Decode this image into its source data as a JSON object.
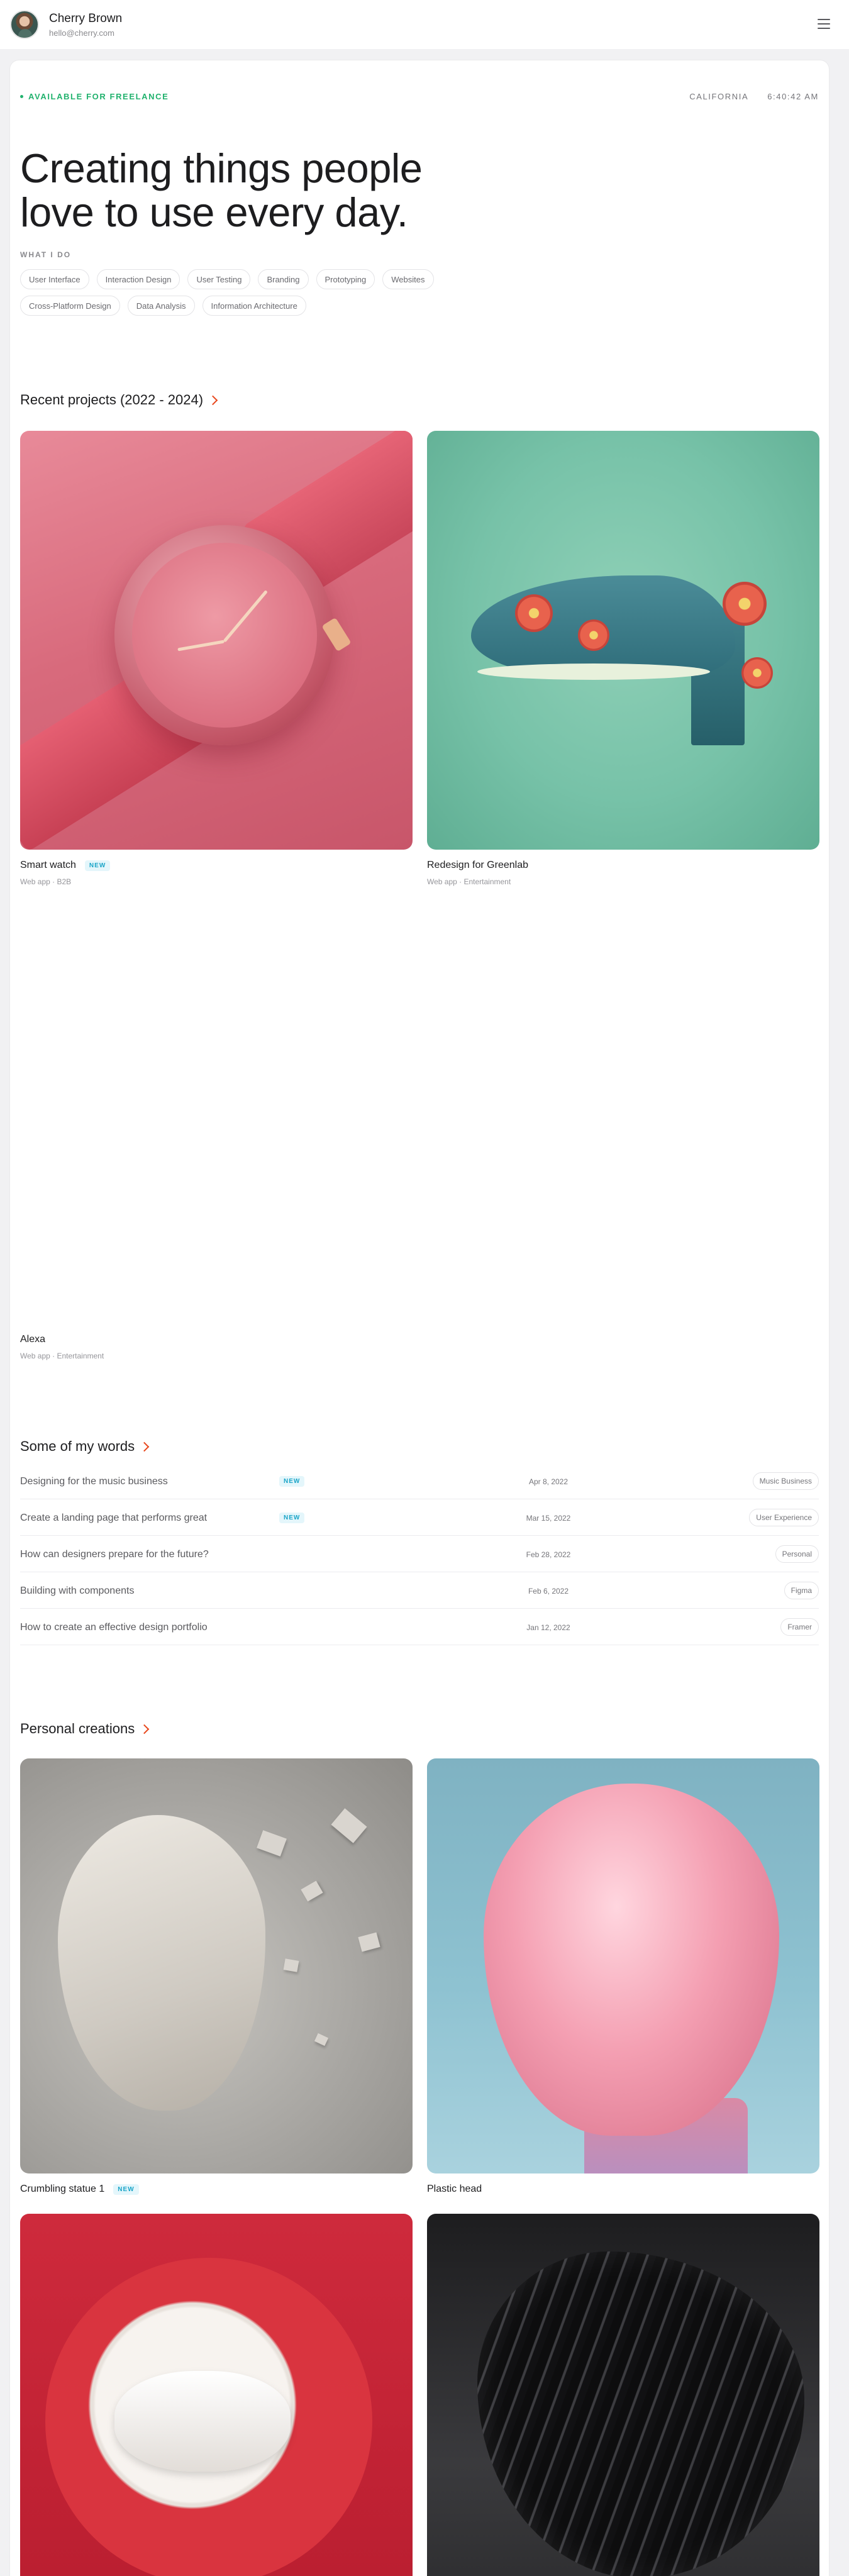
{
  "header": {
    "name": "Cherry Brown",
    "email": "hello@cherry.com"
  },
  "status": {
    "availability": "AVAILABLE FOR FREELANCE",
    "location": "CALIFORNIA",
    "time": "6:40:42 AM"
  },
  "hero": {
    "headline": "Creating things people love to use every day.",
    "what_label": "WHAT I DO",
    "skills": [
      "User Interface",
      "Interaction Design",
      "User Testing",
      "Branding",
      "Prototyping",
      "Websites",
      "Cross-Platform Design",
      "Data Analysis",
      "Information Architecture"
    ]
  },
  "projects": {
    "title": "Recent projects (2022 - 2024)",
    "items": [
      {
        "title": "Smart watch",
        "badge": "NEW",
        "meta": "Web app · B2B"
      },
      {
        "title": "Redesign for Greenlab",
        "meta": "Web app · Entertainment"
      },
      {
        "title": "Alexa",
        "meta": "Web app · Entertainment"
      }
    ]
  },
  "writing": {
    "title": "Some of my words",
    "posts": [
      {
        "title": "Designing for the music business",
        "badge": "NEW",
        "date": "Apr 8, 2022",
        "tag": "Music Business"
      },
      {
        "title": "Create a landing page that performs great",
        "badge": "NEW",
        "date": "Mar 15, 2022",
        "tag": "User Experience"
      },
      {
        "title": "How can designers prepare for the future?",
        "date": "Feb 28, 2022",
        "tag": "Personal"
      },
      {
        "title": "Building with components",
        "date": "Feb 6, 2022",
        "tag": "Figma"
      },
      {
        "title": "How to create an effective design portfolio",
        "date": "Jan 12, 2022",
        "tag": "Framer"
      }
    ]
  },
  "creations": {
    "title": "Personal creations",
    "items": [
      {
        "title": "Crumbling statue 1",
        "badge": "NEW"
      },
      {
        "title": "Plastic head"
      }
    ]
  },
  "colors": {
    "accent": "#e8471c",
    "available": "#22b26e",
    "badge": "#1aa5c8"
  }
}
